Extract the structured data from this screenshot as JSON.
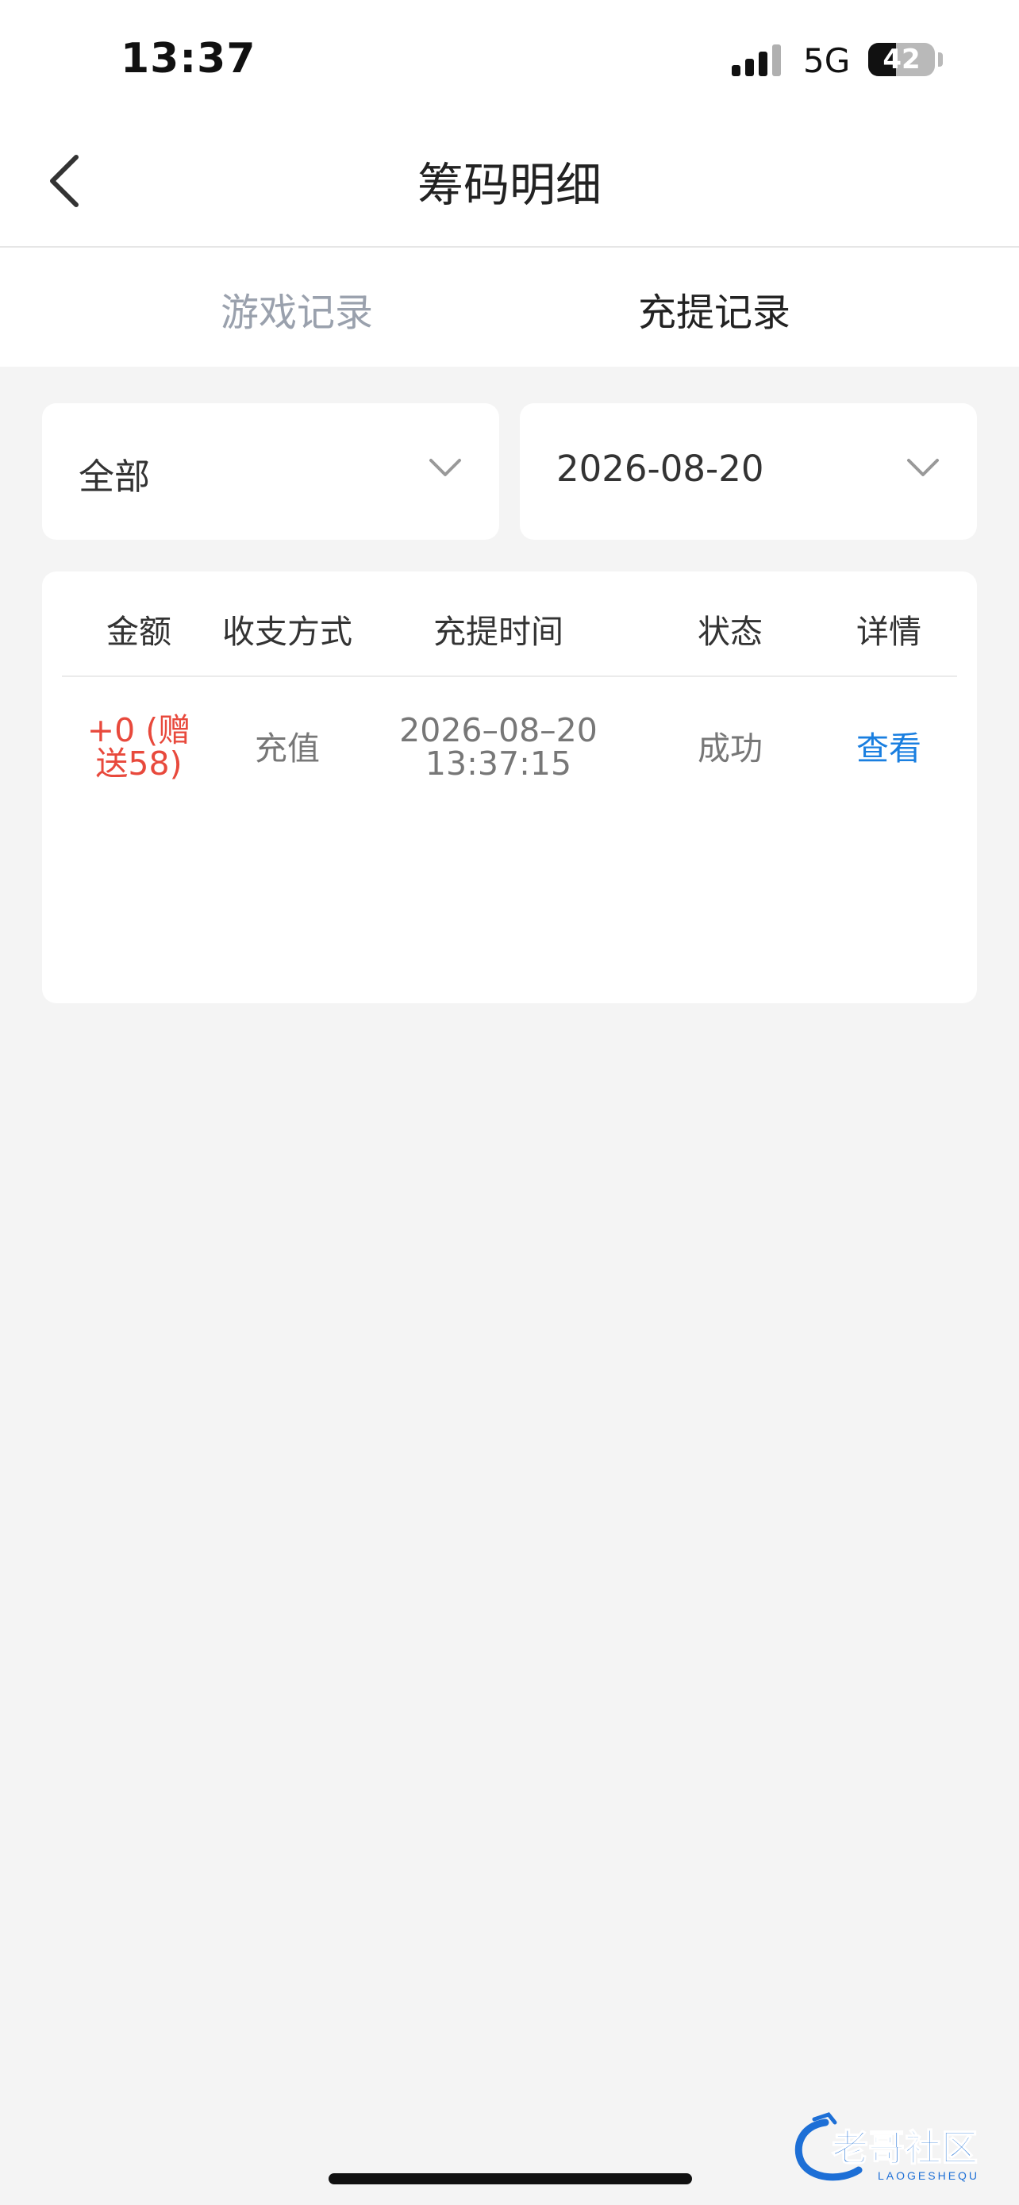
{
  "status_bar": {
    "time": "13:37",
    "network": "5G",
    "battery": 42
  },
  "nav": {
    "title": "筹码明细",
    "back_icon": "chevron-left-icon"
  },
  "tabs": [
    {
      "label": "游戏记录",
      "active": false
    },
    {
      "label": "充提记录",
      "active": true
    }
  ],
  "filters": {
    "type": "全部",
    "date": "2026-08-20",
    "dropdown_icon": "chevron-down-icon"
  },
  "table": {
    "headers": [
      "金额",
      "收支方式",
      "充提时间",
      "状态",
      "详情"
    ],
    "rows": [
      {
        "amount_line1": "+0 (赠",
        "amount_line2": "送58)",
        "method": "充值",
        "date": "2026–08–20",
        "time": "13:37:15",
        "status": "成功",
        "detail": "查看"
      }
    ]
  },
  "watermark": {
    "text": "老哥社区",
    "subtext": "LAOGESHEQU"
  },
  "colors": {
    "amount": "#e8493c",
    "link": "#1a7fe0",
    "inactive_tab": "#9aa1ad",
    "background": "#f4f4f4"
  }
}
